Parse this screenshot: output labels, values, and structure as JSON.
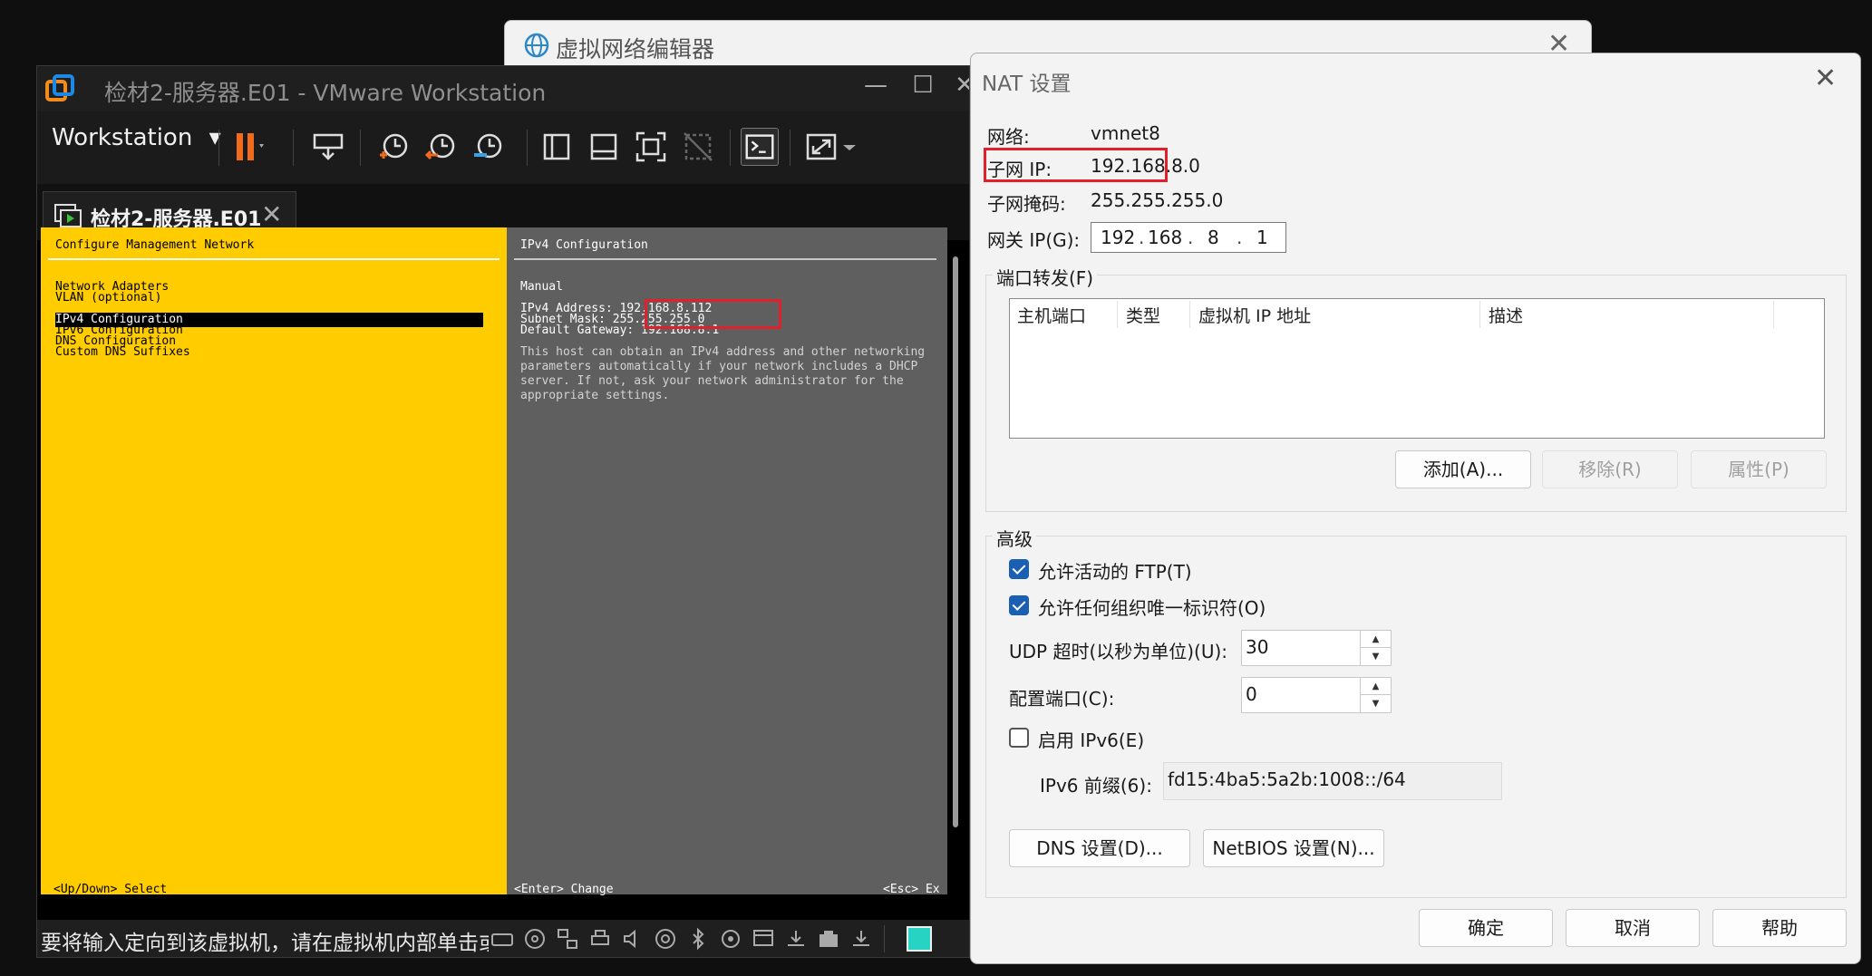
{
  "background_window": {
    "title": "虚拟网络编辑器",
    "close_glyph": "✕"
  },
  "vmware": {
    "title": "检材2-服务器.E01 - VMware Workstation",
    "window_buttons": [
      "—",
      "☐",
      "✕"
    ],
    "menu_label": "Workstation",
    "menu_arrow": "▾",
    "toolbar_icons": [
      "pause-icon",
      "send-ctrl-alt-del-icon",
      "snapshot-icon",
      "revert-snapshot-icon",
      "snapshot-manager-icon",
      "library-icon",
      "thumbnail-icon",
      "fullscreen-icon",
      "unity-icon",
      "console-view-icon",
      "stretch-icon"
    ],
    "tab": {
      "label": "检材2-服务器.E01",
      "close_glyph": "✕"
    },
    "status_text": "要将输入定向到该虚拟机，请在虚拟机内部单击或按 Ctrl+G。",
    "status_icons": [
      "hdd-icon",
      "cd-icon",
      "network-icon",
      "printer-icon",
      "sound-icon",
      "usb-icon",
      "bluetooth-icon",
      "camera-icon",
      "display-icon",
      "download-icon",
      "keyboard-icon",
      "download2-icon",
      "vm-status-icon"
    ]
  },
  "dcui": {
    "left_title": "Configure Management Network",
    "menu_items": [
      "Network Adapters",
      "VLAN (optional)",
      "",
      "IPv4 Configuration",
      "IPv6 Configuration",
      "DNS Configuration",
      "Custom DNS Suffixes"
    ],
    "selected_index": 3,
    "right_title": "IPv4 Configuration",
    "mode": "Manual",
    "ipv4_address": "IPv4 Address: 192.168.8.112",
    "subnet_mask": "Subnet Mask: 255.255.255.0",
    "default_gateway": "Default Gateway: 192.168.8.1",
    "description": "This host can obtain an IPv4 address and other networking\nparameters automatically if your network includes a DHCP\nserver. If not, ask your network administrator for the\nappropriate settings.",
    "footer_left": "<Up/Down> Select",
    "footer_right": "<Enter> Change",
    "footer_esc": "<Esc> Ex"
  },
  "nat_dialog": {
    "title": "NAT 设置",
    "close_glyph": "✕",
    "network_label": "网络:",
    "network_value": "vmnet8",
    "subnet_ip_label": "子网 IP:",
    "subnet_ip_value": "192.168.8.0",
    "subnet_mask_label": "子网掩码:",
    "subnet_mask_value": "255.255.255.0",
    "gateway_label": "网关 IP(G):",
    "gateway_octets": [
      "192",
      "168",
      "8",
      "1"
    ],
    "port_forwarding": {
      "group_label": "端口转发(F)",
      "columns": [
        "主机端口",
        "类型",
        "虚拟机 IP 地址",
        "描述"
      ],
      "rows": [],
      "add_button": "添加(A)...",
      "remove_button": "移除(R)",
      "properties_button": "属性(P)"
    },
    "advanced": {
      "group_label": "高级",
      "allow_active_ftp": "允许活动的 FTP(T)",
      "allow_active_ftp_checked": true,
      "allow_any_oui": "允许任何组织唯一标识符(O)",
      "allow_any_oui_checked": true,
      "udp_timeout_label": "UDP 超时(以秒为单位)(U):",
      "udp_timeout_value": "30",
      "config_port_label": "配置端口(C):",
      "config_port_value": "0",
      "enable_ipv6": "启用 IPv6(E)",
      "enable_ipv6_checked": false,
      "ipv6_prefix_label": "IPv6 前缀(6):",
      "ipv6_prefix_value": "fd15:4ba5:5a2b:1008::/64",
      "dns_button": "DNS 设置(D)...",
      "netbios_button": "NetBIOS 设置(N)..."
    },
    "ok_button": "确定",
    "cancel_button": "取消",
    "help_button": "帮助"
  },
  "colors": {
    "dcui_yellow": "#ffcc00",
    "dcui_gray": "#5f5f5f",
    "highlight_red": "#e0202a",
    "checkbox_blue": "#1a5fb4",
    "pause_orange": "#f26b1d"
  }
}
